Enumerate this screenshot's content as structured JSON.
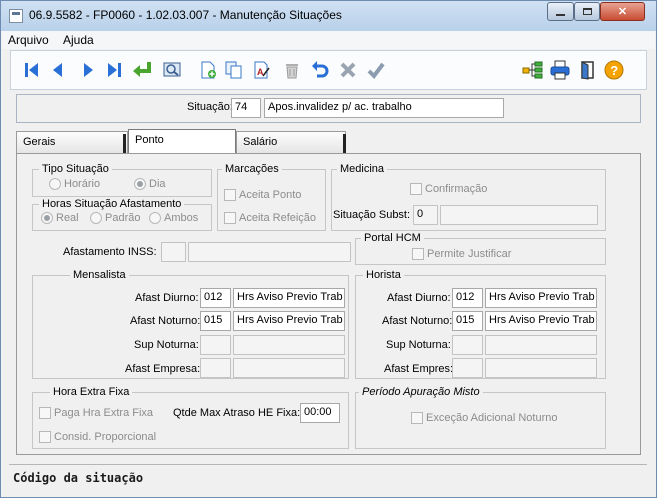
{
  "window": {
    "title": "06.9.5582 - FP0060 - 1.02.03.007 - Manutenção Situações"
  },
  "menu": [
    "Arquivo",
    "Ajuda"
  ],
  "toolbar": {
    "icons": [
      "first-icon",
      "prev-icon",
      "next-icon",
      "last-icon",
      "return-icon",
      "search-icon",
      "new-icon",
      "copy-icon",
      "edit-icon",
      "delete-icon",
      "undo-icon",
      "cancel-icon",
      "confirm-icon",
      "tree-icon",
      "print-icon",
      "exit-icon",
      "help-icon"
    ]
  },
  "situacao": {
    "label": "Situação:",
    "code": "74",
    "description": "Apos.invalidez p/ ac. trabalho"
  },
  "tabs": [
    "Gerais",
    "Ponto",
    "Salário"
  ],
  "tipo_situacao": {
    "title": "Tipo Situação",
    "options": [
      "Horário",
      "Dia"
    ],
    "selected": "Dia"
  },
  "horas_afastamento": {
    "title": "Horas Situação Afastamento",
    "options": [
      "Real",
      "Padrão",
      "Ambos"
    ],
    "selected": "Real"
  },
  "marcacoes": {
    "title": "Marcações",
    "aceita_ponto": "Aceita Ponto",
    "aceita_refeicao": "Aceita Refeição"
  },
  "medicina": {
    "title": "Medicina",
    "confirmacao": "Confirmação",
    "situacao_subst_label": "Situação Subst:",
    "situacao_subst_value": "0",
    "situacao_subst_desc": ""
  },
  "afastamento_inss": {
    "label": "Afastamento INSS:",
    "code": "",
    "desc": ""
  },
  "portal_hcm": {
    "title": "Portal HCM",
    "permite_justificar": "Permite Justificar"
  },
  "mensalista": {
    "title": "Mensalista",
    "rows": [
      {
        "label": "Afast Diurno:",
        "code": "012",
        "desc": "Hrs Aviso Previo Trab"
      },
      {
        "label": "Afast Noturno:",
        "code": "015",
        "desc": "Hrs Aviso Previo Trab"
      },
      {
        "label": "Sup Noturna:",
        "code": "",
        "desc": ""
      },
      {
        "label": "Afast Empresa:",
        "code": "",
        "desc": ""
      }
    ]
  },
  "horista": {
    "title": "Horista",
    "rows": [
      {
        "label": "Afast Diurno:",
        "code": "012",
        "desc": "Hrs Aviso Previo Trab"
      },
      {
        "label": "Afast Noturno:",
        "code": "015",
        "desc": "Hrs Aviso Previo Trab"
      },
      {
        "label": "Sup Noturna:",
        "code": "",
        "desc": ""
      },
      {
        "label": "Afast Empres:",
        "code": "",
        "desc": ""
      }
    ]
  },
  "hora_extra": {
    "title": "Hora Extra Fixa",
    "paga": "Paga Hra Extra Fixa",
    "consid": "Consid. Proporcional",
    "qtde_label": "Qtde Max Atraso HE Fixa:",
    "qtde_value": "00:00"
  },
  "periodo_misto": {
    "title": "Período Apuração Misto",
    "excecao": "Exceção Adicional Noturno"
  },
  "status": {
    "text": "Código da situação"
  }
}
